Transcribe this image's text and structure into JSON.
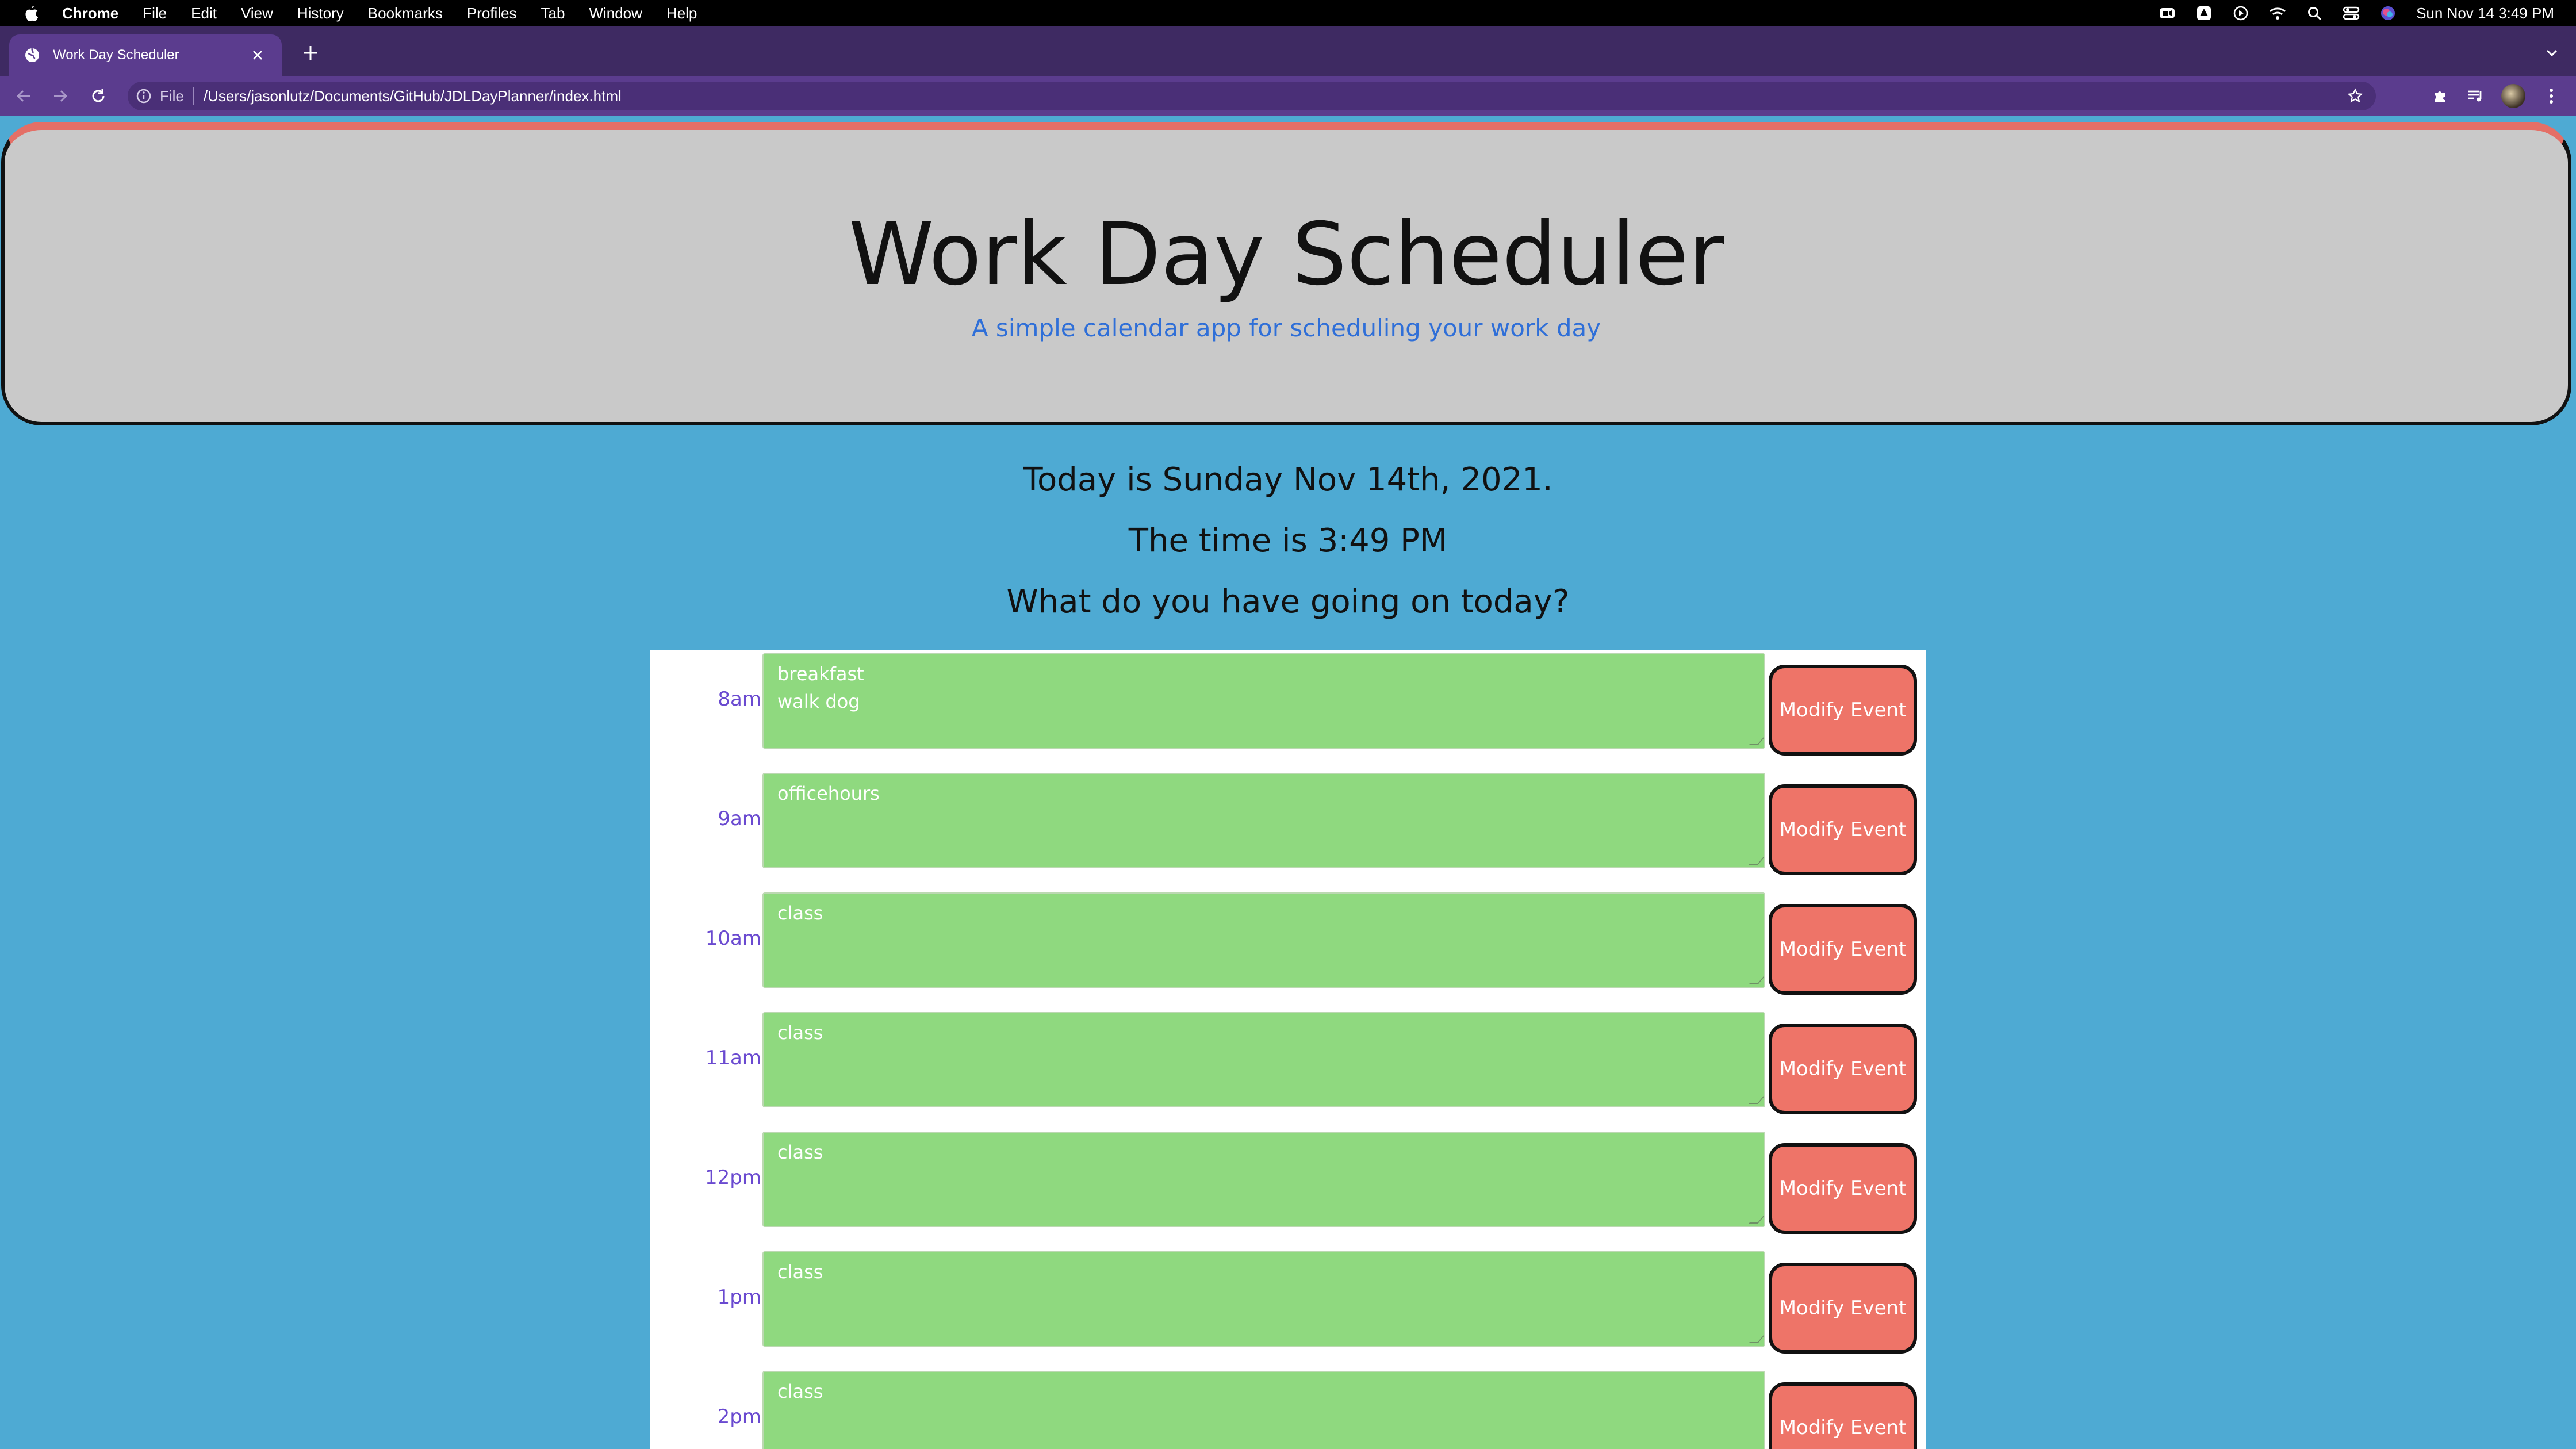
{
  "menubar": {
    "app": "Chrome",
    "items": [
      "File",
      "Edit",
      "View",
      "History",
      "Bookmarks",
      "Profiles",
      "Tab",
      "Window",
      "Help"
    ],
    "clock": "Sun Nov 14  3:49 PM"
  },
  "browser": {
    "tab_title": "Work Day Scheduler",
    "url_scheme": "File",
    "url": "/Users/jasonlutz/Documents/GitHub/JDLDayPlanner/index.html"
  },
  "header": {
    "title": "Work Day Scheduler",
    "lead": "A simple calendar app for scheduling your work day"
  },
  "info": {
    "today": "Today is Sunday Nov 14th, 2021.",
    "time": "The time is 3:49 PM",
    "question": "What do you have going on today?"
  },
  "schedule": [
    {
      "hour": "8am",
      "text": "breakfast\nwalk dog",
      "button": "Modify Event"
    },
    {
      "hour": "9am",
      "text": "officehours",
      "button": "Modify Event"
    },
    {
      "hour": "10am",
      "text": "class",
      "button": "Modify Event"
    },
    {
      "hour": "11am",
      "text": "class",
      "button": "Modify Event"
    },
    {
      "hour": "12pm",
      "text": "class",
      "button": "Modify Event"
    },
    {
      "hour": "1pm",
      "text": "class",
      "button": "Modify Event"
    },
    {
      "hour": "2pm",
      "text": "class",
      "button": "Modify Event"
    }
  ],
  "colors": {
    "page_bg": "#4eaad3",
    "jumbo_bg": "#c9c9c9",
    "lead_text": "#2f6fd8",
    "future_slot": "#8fd97f",
    "button_bg": "#ee7468",
    "hour_text": "#6a4ad0"
  }
}
